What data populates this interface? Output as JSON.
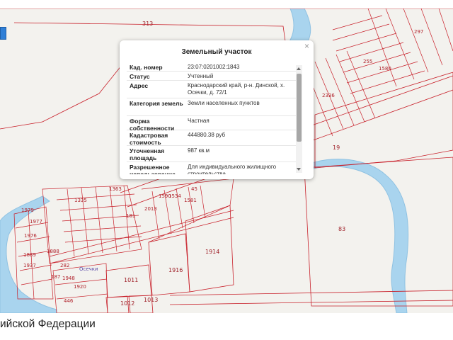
{
  "popup": {
    "title": "Земельный участок",
    "close": "×",
    "rows": [
      {
        "label": "Кад. номер",
        "value": "23:07:0201002:1843"
      },
      {
        "label": "Статус",
        "value": "Учтенный"
      },
      {
        "label": "Адрес",
        "value": "Краснодарский край, р-н. Динской, х. Осечки, д. 72/1"
      },
      {
        "label": "Категория земель",
        "value": "Земли населенных пунктов"
      },
      {
        "label": "Форма собственности",
        "value": "Частная"
      },
      {
        "label": "Кадастровая стоимость",
        "value": "444880.38 руб"
      },
      {
        "label": "Уточненная площадь",
        "value": "987 кв.м"
      },
      {
        "label": "Разрешенное использование",
        "value": "Для индивидуального жилищного строительства"
      }
    ]
  },
  "map": {
    "parcel_labels": [
      "313",
      "19",
      "83",
      "1914",
      "1916",
      "1011",
      "1012",
      "1013",
      "1979",
      "1976",
      "1977",
      "1889",
      "1888",
      "1937",
      "187",
      "282",
      "1920",
      "446",
      "1948",
      "1335",
      "1363",
      "181",
      "2013",
      "1590",
      "1534",
      "1581",
      "45",
      "2336",
      "297",
      "255",
      "1580"
    ],
    "village_label": "Осечки"
  },
  "footer": {
    "text": "ийской Федерации"
  },
  "colors": {
    "parcel_border": "#c8202a",
    "water": "#a9d4ee",
    "accent": "#2f7fd6"
  }
}
